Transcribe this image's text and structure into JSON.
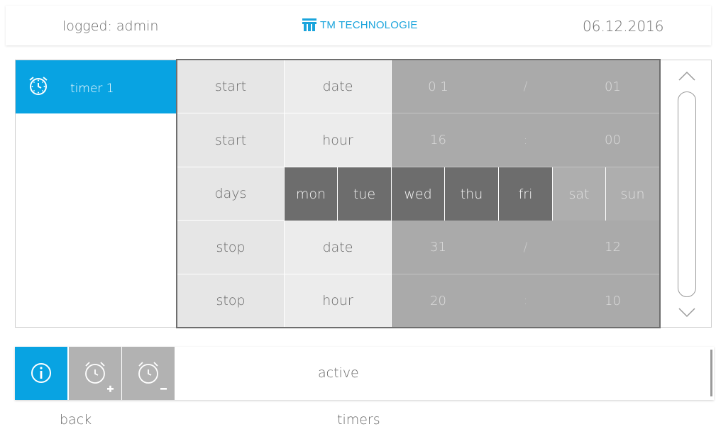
{
  "header": {
    "user": "logged: admin",
    "logo_text": "TM TECHNOLOGIE",
    "date": "06.12.2016"
  },
  "timers": [
    {
      "label": "timer 1",
      "selected": true
    }
  ],
  "schedule": {
    "rows": [
      {
        "label": "start",
        "sub": "date",
        "a": "0 1",
        "sep": "/",
        "b": "01"
      },
      {
        "label": "start",
        "sub": "hour",
        "a": "16",
        "sep": ":",
        "b": "00"
      },
      {
        "label": "days"
      },
      {
        "label": "stop",
        "sub": "date",
        "a": "31",
        "sep": "/",
        "b": "12"
      },
      {
        "label": "stop",
        "sub": "hour",
        "a": "20",
        "sep": ":",
        "b": "10"
      }
    ],
    "days": [
      {
        "label": "mon",
        "active": true
      },
      {
        "label": "tue",
        "active": true
      },
      {
        "label": "wed",
        "active": true
      },
      {
        "label": "thu",
        "active": true
      },
      {
        "label": "fri",
        "active": true
      },
      {
        "label": "sat",
        "active": false
      },
      {
        "label": "sun",
        "active": false
      }
    ]
  },
  "toolbar": {
    "status": "active"
  },
  "footer": {
    "back": "back",
    "title": "timers"
  },
  "colors": {
    "accent": "#08a3e2",
    "logo": "#1aa4dc",
    "day_active": "#6d6d6d",
    "day_inactive": "#aeaeae",
    "value_bg": "#aaaaaa"
  },
  "icons": {
    "timer": "alarm-clock-icon",
    "info": "info-icon",
    "add_timer": "add-timer-icon",
    "remove_timer": "remove-timer-icon",
    "scroll_up": "chevron-up-icon",
    "scroll_down": "chevron-down-icon"
  }
}
